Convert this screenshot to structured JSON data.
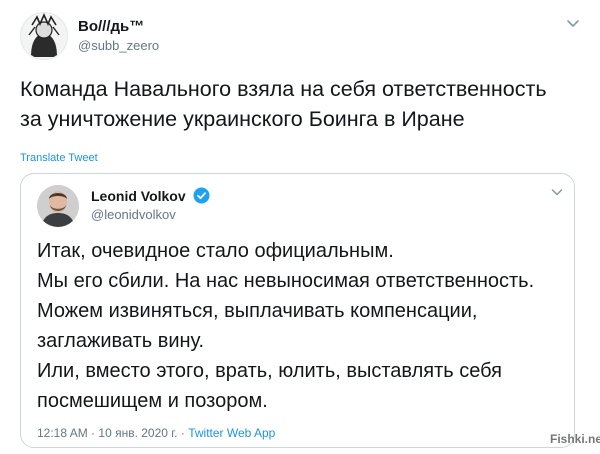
{
  "tweet": {
    "author": {
      "name": "Во///дь™",
      "handle": "@subb_zeero"
    },
    "text_lines": [
      "Команда Навального взяла на себя ответственность",
      "за уничтожение украинского Боинга в Иране"
    ],
    "translate_label": "Translate Tweet",
    "icons": {
      "menu": "chevron-down-icon",
      "avatar": "profile-avatar"
    }
  },
  "quoted": {
    "author": {
      "name": "Leonid Volkov",
      "handle": "@leonidvolkov",
      "verified": true
    },
    "text_lines": [
      "Итак, очевидное стало официальным.",
      "Мы его сбили. На нас невыносимая ответственность.",
      "Можем извиняться, выплачивать компенсации,",
      "заглаживать вину.",
      "Или, вместо этого, врать, юлить, выставлять себя",
      "посмешищем и позором."
    ],
    "time": "12:18 AM",
    "separator": "·",
    "date": "10 янв. 2020 г.",
    "app": "Twitter Web App"
  },
  "watermark": "Fishki.net",
  "colors": {
    "link": "#1b95e0",
    "muted": "#657786",
    "border": "#ccd6dd",
    "verified": "#1da1f2"
  }
}
